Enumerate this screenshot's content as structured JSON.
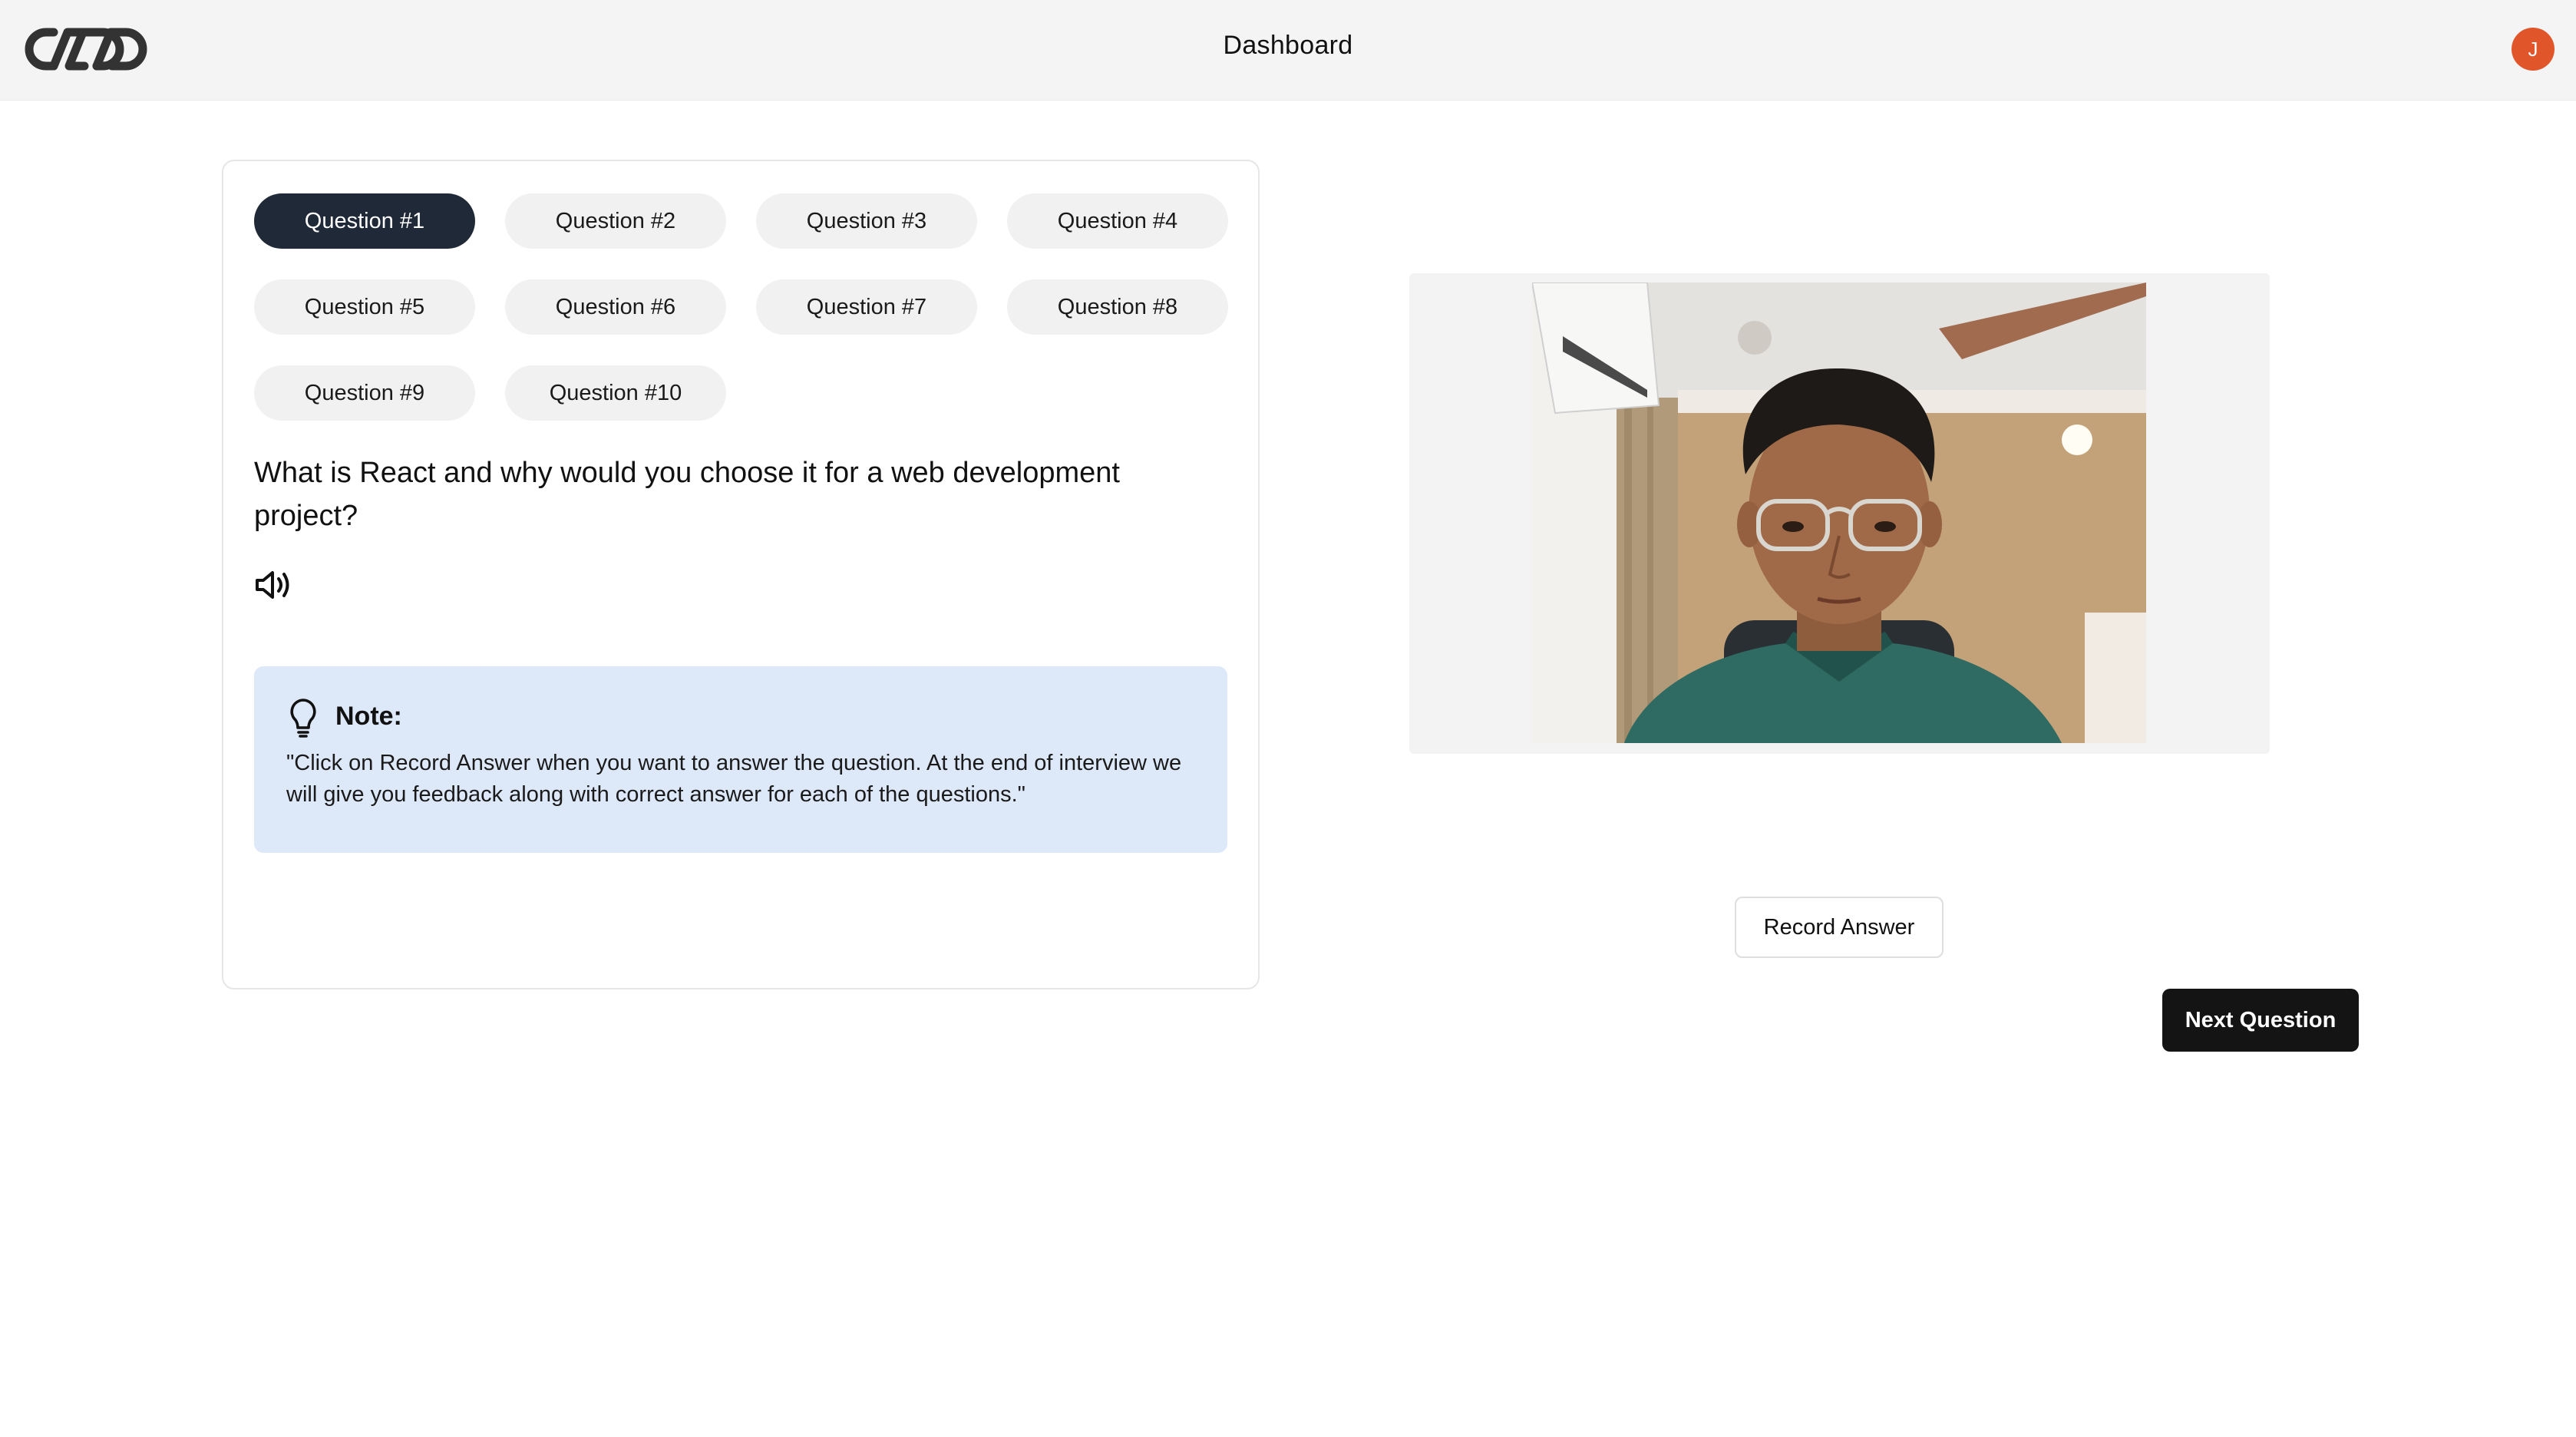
{
  "header": {
    "title": "Dashboard",
    "avatar_initial": "J",
    "logo_icon": "infinity-chain-logo",
    "avatar_color": "#e0562a"
  },
  "questions": {
    "tabs": [
      {
        "label": "Question #1",
        "active": true
      },
      {
        "label": "Question #2",
        "active": false
      },
      {
        "label": "Question #3",
        "active": false
      },
      {
        "label": "Question #4",
        "active": false
      },
      {
        "label": "Question #5",
        "active": false
      },
      {
        "label": "Question #6",
        "active": false
      },
      {
        "label": "Question #7",
        "active": false
      },
      {
        "label": "Question #8",
        "active": false
      },
      {
        "label": "Question #9",
        "active": false
      },
      {
        "label": "Question #10",
        "active": false
      }
    ],
    "current_text": "What is React and why would you choose it for a web development project?",
    "speak_icon": "speaker-icon"
  },
  "note": {
    "icon": "lightbulb-icon",
    "title": "Note:",
    "body": "\"Click on Record Answer when you want to answer the question. At the end of interview we will give you feedback along with correct answer for each of the questions.\"",
    "background": "#dde8f9"
  },
  "actions": {
    "record_label": "Record Answer",
    "next_label": "Next Question"
  },
  "colors": {
    "active_tab": "#1f2937",
    "tab_bg": "#f1f1f1",
    "primary_button": "#141414"
  }
}
